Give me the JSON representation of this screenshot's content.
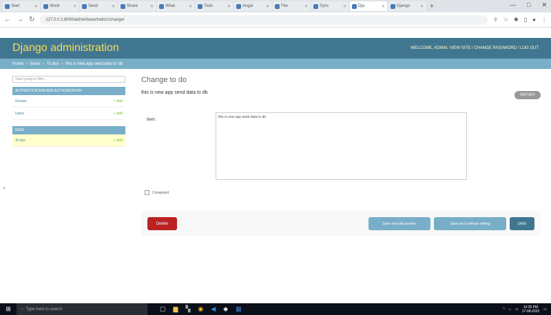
{
  "browser": {
    "tabs": [
      {
        "label": "Start"
      },
      {
        "label": "Word"
      },
      {
        "label": "Send"
      },
      {
        "label": "Share"
      },
      {
        "label": "What"
      },
      {
        "label": "Todo"
      },
      {
        "label": "Angul"
      },
      {
        "label": "Fbx"
      },
      {
        "label": "Sync"
      },
      {
        "label": "Dja"
      },
      {
        "label": "Django"
      }
    ],
    "new_tab": "+",
    "url": "127.0.0.1:8000/admin/base/todo/1/change/",
    "window_controls": [
      "—",
      "□",
      "✕"
    ]
  },
  "header": {
    "brand": "Django administration",
    "user_tools": "WELCOME, ADMIN. VIEW SITE / CHANGE PASSWORD / LOG OUT"
  },
  "breadcrumbs": {
    "home": "Home",
    "sep1": "›",
    "app": "Base",
    "sep2": "›",
    "model": "To dos",
    "sep3": "›",
    "current": "this is new app send data to db"
  },
  "sidebar": {
    "filter_placeholder": "Start typing to filter...",
    "modules": [
      {
        "caption": "AUTHENTICATION AND AUTHORIZATION",
        "rows": [
          {
            "name": "Groups",
            "add": "+ Add"
          },
          {
            "name": "Users",
            "add": "+ Add"
          }
        ]
      },
      {
        "caption": "BASE",
        "rows": [
          {
            "name": "To dos",
            "add": "+ Add"
          }
        ]
      }
    ],
    "toggle": "«"
  },
  "main": {
    "title": "Change to do",
    "subtitle": "this is new app send data to db",
    "history_button": "HISTORY",
    "field_label": "Item:",
    "field_value": "this is new app send data to db",
    "checkbox_label": "Completed",
    "delete_button": "Delete",
    "save_add_button": "Save and add another",
    "save_continue_button": "Save and continue editing",
    "save_button": "SAVE"
  },
  "taskbar": {
    "search_placeholder": "Type here to search",
    "time": "10:25 PM",
    "date": "17-08-2022"
  },
  "colors": {
    "header": "#417690",
    "breadcrumbs": "#79aec8",
    "brand": "#f5dd5d",
    "delete": "#ba2121"
  }
}
